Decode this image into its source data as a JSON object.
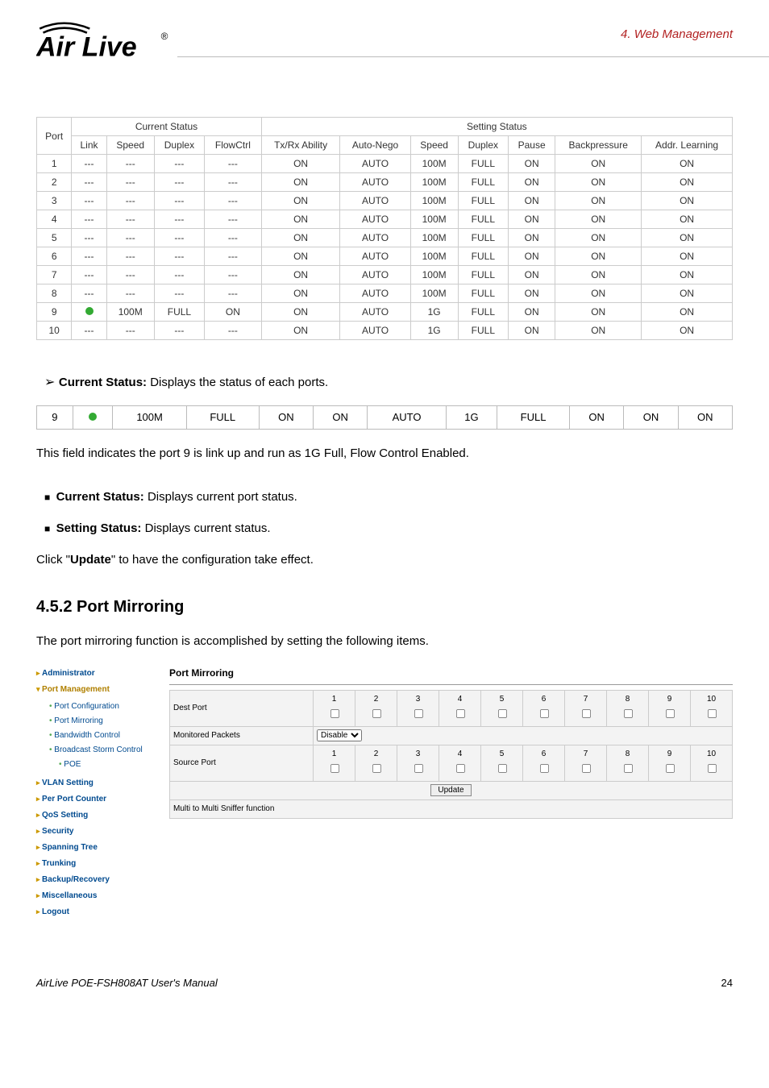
{
  "header": {
    "chapter": "4. Web Management",
    "logo_text": "Air Live"
  },
  "status_table": {
    "group_headers": {
      "port": "Port",
      "current": "Current Status",
      "setting": "Setting Status"
    },
    "columns": [
      "Link",
      "Speed",
      "Duplex",
      "FlowCtrl",
      "Tx/Rx Ability",
      "Auto-Nego",
      "Speed",
      "Duplex",
      "Pause",
      "Backpressure",
      "Addr. Learning"
    ],
    "rows": [
      {
        "port": "1",
        "link": "---",
        "speed": "---",
        "duplex": "---",
        "flow": "---",
        "txrx": "ON",
        "auto": "AUTO",
        "sspeed": "100M",
        "sduplex": "FULL",
        "pause": "ON",
        "back": "ON",
        "addr": "ON"
      },
      {
        "port": "2",
        "link": "---",
        "speed": "---",
        "duplex": "---",
        "flow": "---",
        "txrx": "ON",
        "auto": "AUTO",
        "sspeed": "100M",
        "sduplex": "FULL",
        "pause": "ON",
        "back": "ON",
        "addr": "ON"
      },
      {
        "port": "3",
        "link": "---",
        "speed": "---",
        "duplex": "---",
        "flow": "---",
        "txrx": "ON",
        "auto": "AUTO",
        "sspeed": "100M",
        "sduplex": "FULL",
        "pause": "ON",
        "back": "ON",
        "addr": "ON"
      },
      {
        "port": "4",
        "link": "---",
        "speed": "---",
        "duplex": "---",
        "flow": "---",
        "txrx": "ON",
        "auto": "AUTO",
        "sspeed": "100M",
        "sduplex": "FULL",
        "pause": "ON",
        "back": "ON",
        "addr": "ON"
      },
      {
        "port": "5",
        "link": "---",
        "speed": "---",
        "duplex": "---",
        "flow": "---",
        "txrx": "ON",
        "auto": "AUTO",
        "sspeed": "100M",
        "sduplex": "FULL",
        "pause": "ON",
        "back": "ON",
        "addr": "ON"
      },
      {
        "port": "6",
        "link": "---",
        "speed": "---",
        "duplex": "---",
        "flow": "---",
        "txrx": "ON",
        "auto": "AUTO",
        "sspeed": "100M",
        "sduplex": "FULL",
        "pause": "ON",
        "back": "ON",
        "addr": "ON"
      },
      {
        "port": "7",
        "link": "---",
        "speed": "---",
        "duplex": "---",
        "flow": "---",
        "txrx": "ON",
        "auto": "AUTO",
        "sspeed": "100M",
        "sduplex": "FULL",
        "pause": "ON",
        "back": "ON",
        "addr": "ON"
      },
      {
        "port": "8",
        "link": "---",
        "speed": "---",
        "duplex": "---",
        "flow": "---",
        "txrx": "ON",
        "auto": "AUTO",
        "sspeed": "100M",
        "sduplex": "FULL",
        "pause": "ON",
        "back": "ON",
        "addr": "ON"
      },
      {
        "port": "9",
        "link": "●",
        "speed": "100M",
        "duplex": "FULL",
        "flow": "ON",
        "txrx": "ON",
        "auto": "AUTO",
        "sspeed": "1G",
        "sduplex": "FULL",
        "pause": "ON",
        "back": "ON",
        "addr": "ON"
      },
      {
        "port": "10",
        "link": "---",
        "speed": "---",
        "duplex": "---",
        "flow": "---",
        "txrx": "ON",
        "auto": "AUTO",
        "sspeed": "1G",
        "sduplex": "FULL",
        "pause": "ON",
        "back": "ON",
        "addr": "ON"
      }
    ]
  },
  "text": {
    "cs_bold": "Current Status:",
    "cs_rest": " Displays the status of each ports.",
    "row9_link": "●",
    "row9_speed": "100M",
    "row9_duplex": "FULL",
    "row9_flow": "ON",
    "row9_txrx": "ON",
    "row9_auto": "AUTO",
    "row9_sspeed": "1G",
    "row9_sduplex": "FULL",
    "row9_pause": "ON",
    "row9_back": "ON",
    "row9_addr": "ON",
    "row9_port": "9",
    "row9_sentence": "This field indicates the port 9 is link up and run as 1G Full, Flow Control Enabled.",
    "bullet1_bold": "Current Status:",
    "bullet1_rest": " Displays current port status.",
    "bullet2_bold": "Setting Status:",
    "bullet2_rest": " Displays current status.",
    "click_pre": "Click \"",
    "click_bold": "Update",
    "click_post": "\" to have the configuration take effect.",
    "section_title": "4.5.2 Port Mirroring",
    "section_intro": "The port mirroring function is accomplished by setting the following items."
  },
  "mirror": {
    "sidebar": {
      "items": [
        {
          "label": "Administrator",
          "kind": "top"
        },
        {
          "label": "Port Management",
          "kind": "top-active"
        },
        {
          "label": "Port Configuration",
          "kind": "sub"
        },
        {
          "label": "Port Mirroring",
          "kind": "sub"
        },
        {
          "label": "Bandwidth Control",
          "kind": "sub"
        },
        {
          "label": "Broadcast Storm Control",
          "kind": "sub"
        },
        {
          "label": "POE",
          "kind": "sub2"
        },
        {
          "label": "VLAN Setting",
          "kind": "top"
        },
        {
          "label": "Per Port Counter",
          "kind": "top"
        },
        {
          "label": "QoS Setting",
          "kind": "top"
        },
        {
          "label": "Security",
          "kind": "top"
        },
        {
          "label": "Spanning Tree",
          "kind": "top"
        },
        {
          "label": "Trunking",
          "kind": "top"
        },
        {
          "label": "Backup/Recovery",
          "kind": "top"
        },
        {
          "label": "Miscellaneous",
          "kind": "top"
        },
        {
          "label": "Logout",
          "kind": "top"
        }
      ]
    },
    "panel_title": "Port Mirroring",
    "rows": {
      "dest": "Dest Port",
      "monitored": "Monitored Packets",
      "monitored_value": "Disable",
      "source": "Source Port",
      "update": "Update",
      "note": "Multi to Multi Sniffer function"
    },
    "ports": [
      "1",
      "2",
      "3",
      "4",
      "5",
      "6",
      "7",
      "8",
      "9",
      "10"
    ]
  },
  "footer": {
    "manual": "AirLive POE-FSH808AT User's Manual",
    "page": "24"
  }
}
